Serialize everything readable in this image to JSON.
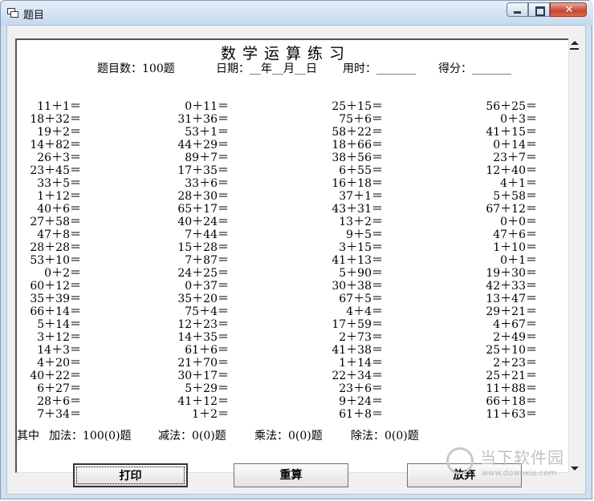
{
  "window": {
    "title": "题目"
  },
  "sheet": {
    "title": "数学运算练习",
    "count_label": "题目数：100题",
    "date_label": "日期：__年__月__日",
    "time_label": "用时：_______",
    "score_label": "得分：_______"
  },
  "problems": {
    "col1": [
      "11＋1＝",
      "18＋32＝",
      "19＋2＝",
      "14＋82＝",
      "26＋3＝",
      "23＋45＝",
      "33＋5＝",
      "1＋12＝",
      "40＋6＝",
      "27＋58＝",
      "47＋8＝",
      "28＋28＝",
      "53＋10＝",
      "0＋2＝",
      "60＋12＝",
      "35＋39＝",
      "66＋14＝",
      "5＋14＝",
      "3＋12＝",
      "14＋3＝",
      "4＋20＝",
      "40＋22＝",
      "6＋27＝",
      "28＋6＝",
      "7＋34＝"
    ],
    "col2": [
      "0＋11＝",
      "31＋36＝",
      "53＋1＝",
      "44＋29＝",
      "89＋7＝",
      "17＋35＝",
      "33＋6＝",
      "28＋30＝",
      "65＋17＝",
      "40＋24＝",
      "7＋44＝",
      "15＋28＝",
      "7＋87＝",
      "24＋25＝",
      "0＋37＝",
      "35＋20＝",
      "75＋4＝",
      "12＋23＝",
      "14＋35＝",
      "61＋6＝",
      "21＋70＝",
      "30＋17＝",
      "5＋29＝",
      "41＋12＝",
      "1＋2＝"
    ],
    "col3": [
      "25＋15＝",
      "75＋6＝",
      "58＋22＝",
      "18＋66＝",
      "38＋56＝",
      "6＋55＝",
      "16＋18＝",
      "37＋1＝",
      "43＋31＝",
      "13＋2＝",
      "9＋5＝",
      "3＋15＝",
      "41＋13＝",
      "5＋90＝",
      "30＋38＝",
      "67＋5＝",
      "4＋4＝",
      "17＋59＝",
      "2＋73＝",
      "41＋38＝",
      "1＋14＝",
      "22＋34＝",
      "23＋6＝",
      "9＋24＝",
      "61＋8＝"
    ],
    "col4": [
      "56＋25＝",
      "0＋3＝",
      "41＋15＝",
      "0＋14＝",
      "23＋7＝",
      "12＋40＝",
      "4＋1＝",
      "5＋58＝",
      "67＋12＝",
      "0＋0＝",
      "47＋6＝",
      "1＋10＝",
      "0＋1＝",
      "19＋30＝",
      "42＋33＝",
      "13＋47＝",
      "29＋21＝",
      "4＋67＝",
      "2＋49＝",
      "25＋10＝",
      "2＋23＝",
      "25＋21＝",
      "11＋88＝",
      "66＋18＝",
      "11＋63＝"
    ]
  },
  "summary": {
    "prefix": "其中",
    "add": "加法：100(0)题",
    "sub": "减法：0(0)题",
    "mul": "乘法：0(0)题",
    "div": "除法：0(0)题"
  },
  "buttons": {
    "print": "打印",
    "recalc": "重算",
    "abandon": "放弃"
  },
  "watermark": {
    "text": "当下软件园",
    "url": "www.downxia.com"
  }
}
